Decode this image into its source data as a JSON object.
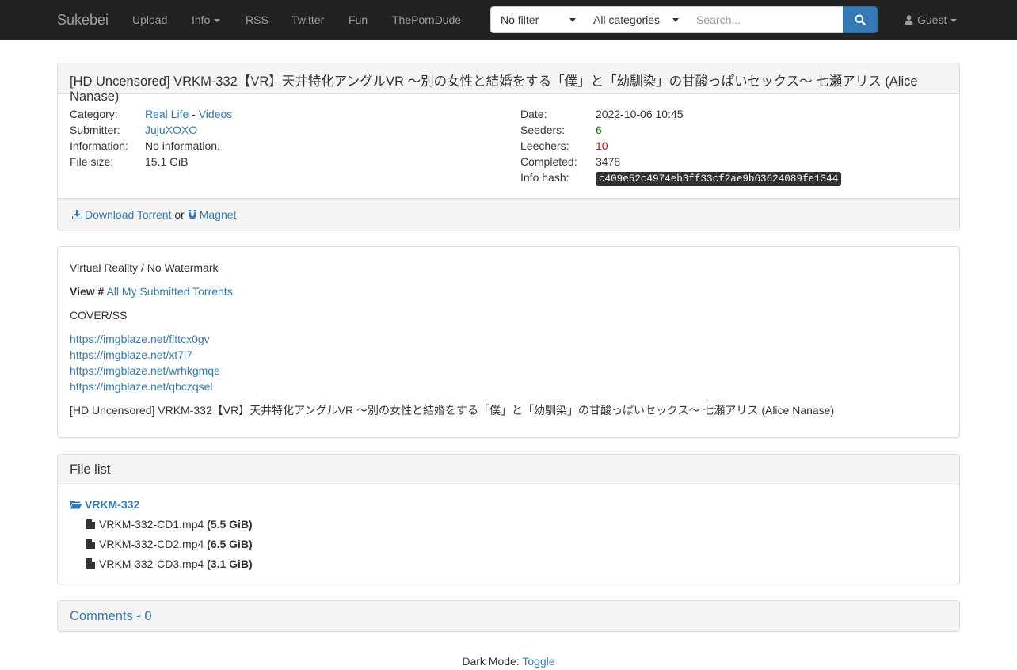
{
  "nav": {
    "brand": "Sukebei",
    "links": [
      "Upload",
      "Info",
      "RSS",
      "Twitter",
      "Fun",
      "ThePornDude"
    ],
    "filter": "No filter",
    "category": "All categories",
    "search_placeholder": "Search...",
    "user": "Guest"
  },
  "torrent": {
    "title": "[HD Uncensored] VRKM-332【VR】天井特化アングルVR ～別の女性と結婚をする「僕」と「幼馴染」の甘酸っぱいセックス～ 七瀬アリス (Alice Nanase)",
    "labels": {
      "category": "Category:",
      "submitter": "Submitter:",
      "information": "Information:",
      "file_size": "File size:",
      "date": "Date:",
      "seeders": "Seeders:",
      "leechers": "Leechers:",
      "completed": "Completed:",
      "info_hash": "Info hash:"
    },
    "category_main": "Real Life",
    "category_sep": "-",
    "category_sub": "Videos",
    "submitter": "JujuXOXO",
    "information": "No information.",
    "file_size": "15.1 GiB",
    "date": "2022-10-06 10:45",
    "seeders": "6",
    "leechers": "10",
    "completed": "3478",
    "info_hash": "c409e52c4974eb3ff33cf2ae9b63624089fe1344",
    "download_label": "Download Torrent",
    "or_text": "or",
    "magnet_label": "Magnet"
  },
  "description": {
    "line1": "Virtual Reality / No Watermark",
    "view_label": "View #",
    "view_link": "All My Submitted Torrents",
    "cover": "COVER/SS",
    "links": [
      "https://imgblaze.net/flttcx0gv",
      "https://imgblaze.net/xt7l7",
      "https://imgblaze.net/wrhkgmqe",
      "https://imgblaze.net/qbczqsel"
    ],
    "footer_title": "[HD Uncensored] VRKM-332【VR】天井特化アングルVR ～別の女性と結婚をする「僕」と「幼馴染」の甘酸っぱいセックス～ 七瀬アリス (Alice Nanase)"
  },
  "file_list": {
    "heading": "File list",
    "folder": "VRKM-332",
    "files": [
      {
        "name": "VRKM-332-CD1.mp4",
        "size": "(5.5 GiB)"
      },
      {
        "name": "VRKM-332-CD2.mp4",
        "size": "(6.5 GiB)"
      },
      {
        "name": "VRKM-332-CD3.mp4",
        "size": "(3.1 GiB)"
      }
    ]
  },
  "comments": {
    "heading": "Comments - 0"
  },
  "footer": {
    "dark_mode_label": "Dark Mode:",
    "toggle": "Toggle"
  }
}
